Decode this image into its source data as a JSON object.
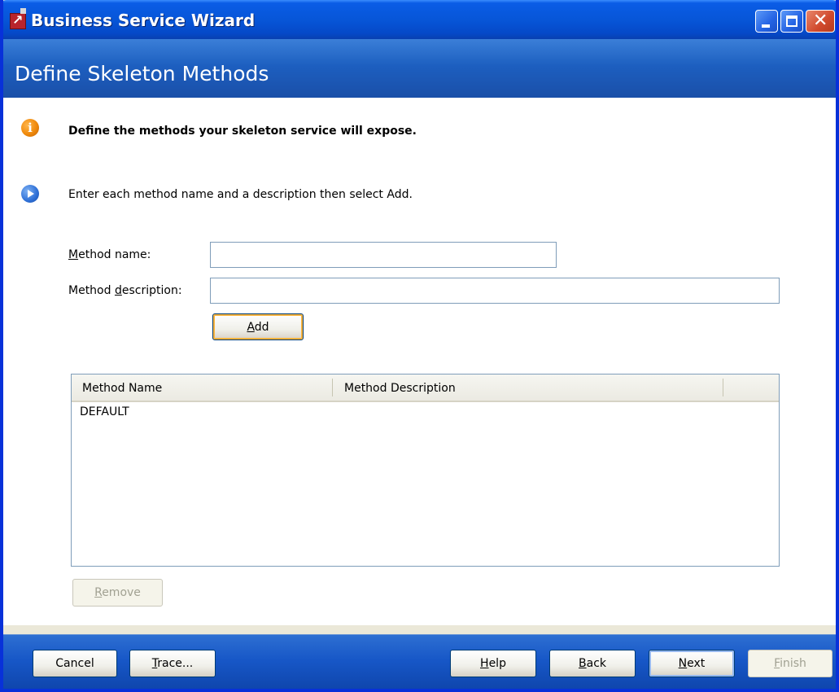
{
  "window": {
    "title": "Business Service Wizard"
  },
  "banner": {
    "title": "Define Skeleton Methods"
  },
  "content": {
    "heading": "Define the methods your skeleton service will expose.",
    "instruction": "Enter each method name and a description then select Add.",
    "method_name_label": "Method name:",
    "method_name_value": "",
    "method_description_label": "Method description:",
    "method_description_value": "",
    "add_label": "Add",
    "remove_label": "Remove"
  },
  "table": {
    "columns": [
      "Method Name",
      "Method Description"
    ],
    "rows": [
      {
        "name": "DEFAULT",
        "description": ""
      }
    ]
  },
  "footer": {
    "cancel_label": "Cancel",
    "trace_label": "Trace...",
    "help_label": "Help",
    "back_label": "Back",
    "next_label": "Next",
    "finish_label": "Finish"
  },
  "icons": {
    "app": "wizard-app-icon",
    "info": "info-icon",
    "step": "step-arrow-icon"
  }
}
